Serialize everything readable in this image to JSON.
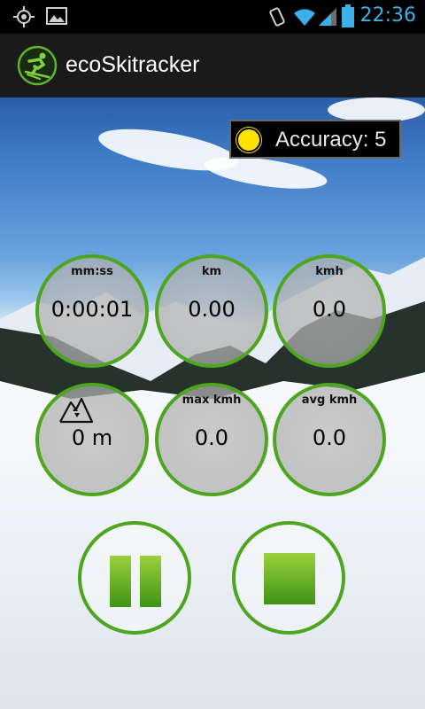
{
  "status_bar": {
    "time": "22:36",
    "icons": [
      "gps-icon",
      "image-icon",
      "vibrate-icon",
      "wifi-icon",
      "signal-icon",
      "battery-icon"
    ]
  },
  "action_bar": {
    "title": "ecoSkitracker",
    "logo_icon": "skier-icon"
  },
  "accuracy": {
    "label": "Accuracy: 5",
    "indicator_color": "#ffe200"
  },
  "gauges": {
    "time": {
      "label": "mm:ss",
      "value": "0:00:01"
    },
    "distance": {
      "label": "km",
      "value": "0.00"
    },
    "speed": {
      "label": "kmh",
      "value": "0.0"
    },
    "altitude": {
      "label_icon": "mountain-icon",
      "value": "0 m"
    },
    "max_speed": {
      "label": "max kmh",
      "value": "0.0"
    },
    "avg_speed": {
      "label": "avg kmh",
      "value": "0.0"
    }
  },
  "controls": {
    "pause_icon": "pause-icon",
    "stop_icon": "stop-icon"
  },
  "colors": {
    "accent_green": "#4ea51f",
    "time_blue": "#3ab2e8"
  }
}
